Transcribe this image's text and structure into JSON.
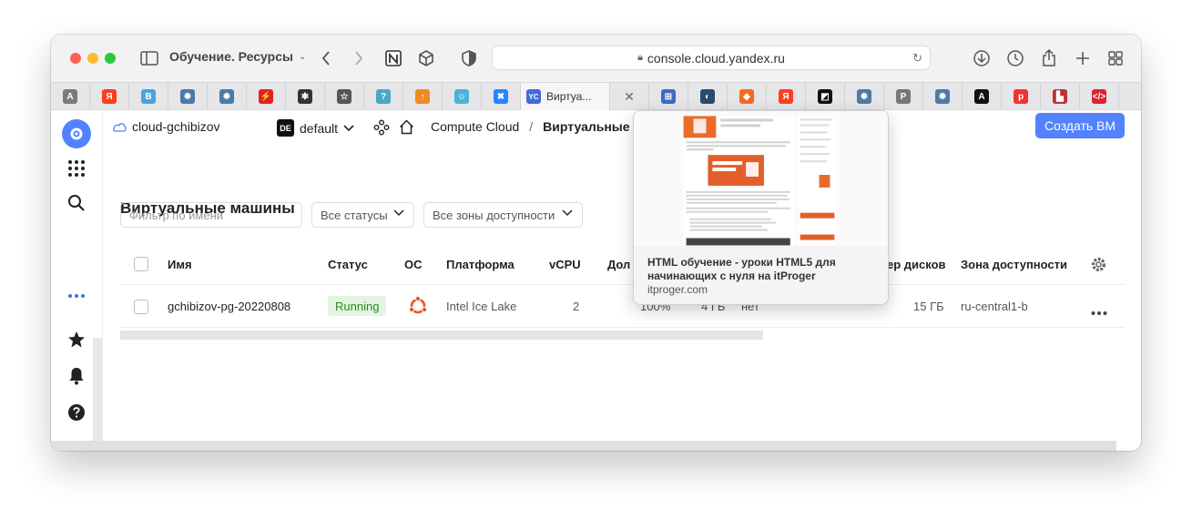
{
  "browser": {
    "tab_group_title": "Обучение. Ресурсы",
    "url": "console.cloud.yandex.ru",
    "active_tab_label": "Виртуа...",
    "pinned_tabs": [
      {
        "icon": "A",
        "color": "#7a7a7a"
      },
      {
        "icon": "Я",
        "color": "#fc3f1d"
      },
      {
        "icon": "B",
        "color": "#4aa3df"
      },
      {
        "icon": "✹",
        "color": "#4a7aa8"
      },
      {
        "icon": "✹",
        "color": "#4a7aa8"
      },
      {
        "icon": "⚡",
        "color": "#d22"
      },
      {
        "icon": "✱",
        "color": "#333"
      },
      {
        "icon": "☆",
        "color": "#555"
      },
      {
        "icon": "?",
        "color": "#4aa8c4"
      },
      {
        "icon": "↑",
        "color": "#f08a24"
      },
      {
        "icon": "☺",
        "color": "#4ab3d6"
      },
      {
        "icon": "✖",
        "color": "#2684ff"
      }
    ],
    "right_tabs": [
      {
        "icon": "⊞",
        "color": "#3f6cc2"
      },
      {
        "icon": "◐",
        "color": "#2b4a6e"
      },
      {
        "icon": "◆",
        "color": "#f56b1c"
      },
      {
        "icon": "Я",
        "color": "#fc3f1d"
      },
      {
        "icon": "◩",
        "color": "#111"
      },
      {
        "icon": "✹",
        "color": "#4a7aa8"
      },
      {
        "icon": "P",
        "color": "#777"
      },
      {
        "icon": "✹",
        "color": "#4a7aa8"
      },
      {
        "icon": "A",
        "color": "#111"
      },
      {
        "icon": "p",
        "color": "#e33"
      },
      {
        "icon": "▙",
        "color": "#b33"
      },
      {
        "icon": "</>",
        "color": "#d23"
      }
    ]
  },
  "header": {
    "cloud": "cloud-gchibizov",
    "folder_badge": "DE",
    "folder": "default",
    "service": "Compute Cloud",
    "separator": "/",
    "section": "Виртуальные машины",
    "create_button": "Создать ВМ"
  },
  "page": {
    "title": "Виртуальные машины",
    "filter_placeholder": "Фильтр по имени",
    "status_filter": "Все статусы",
    "zone_filter": "Все зоны доступности"
  },
  "table": {
    "headers": [
      "Имя",
      "Статус",
      "ОС",
      "Платформа",
      "vCPU",
      "Дол",
      "ер дисков",
      "Зона доступности"
    ],
    "rows": [
      {
        "name": "gchibizov-pg-20220808",
        "status": "Running",
        "os": "ubuntu",
        "platform": "Intel Ice Lake",
        "vcpu": "2",
        "share": "100%",
        "ram": "4 ГБ",
        "preemptible": "нет",
        "disk": "15 ГБ",
        "zone": "ru-central1-b"
      }
    ]
  },
  "preview": {
    "title": "HTML обучение - уроки HTML5 для начинающих с нуля на itProger",
    "url": "itproger.com"
  },
  "colors": {
    "accent": "#5282ff",
    "running_bg": "#e3f4e1",
    "running_text": "#2b8a1f",
    "ubuntu": "#e95420"
  }
}
